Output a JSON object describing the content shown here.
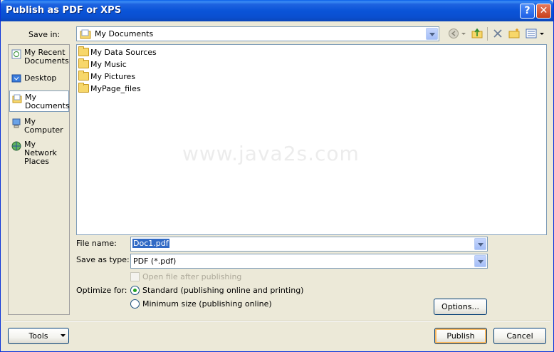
{
  "window": {
    "title": "Publish as PDF or XPS",
    "help_glyph": "?",
    "close_glyph": "✕"
  },
  "save_in": {
    "label": "Save in:",
    "value": "My Documents"
  },
  "places": [
    {
      "label": "My Recent Documents",
      "icon": "recent-documents-icon"
    },
    {
      "label": "Desktop",
      "icon": "desktop-icon"
    },
    {
      "label": "My Documents",
      "icon": "my-documents-icon"
    },
    {
      "label": "My Computer",
      "icon": "my-computer-icon"
    },
    {
      "label": "My Network Places",
      "icon": "network-places-icon"
    }
  ],
  "files": [
    {
      "name": "My Data Sources"
    },
    {
      "name": "My Music"
    },
    {
      "name": "My Pictures"
    },
    {
      "name": "MyPage_files"
    }
  ],
  "watermark": "www.java2s.com",
  "file_name": {
    "label": "File name:",
    "value": "Doc1.pdf"
  },
  "save_as_type": {
    "label": "Save as type:",
    "value": "PDF (*.pdf)"
  },
  "open_after": {
    "label": "Open file after publishing"
  },
  "optimize": {
    "label": "Optimize for:",
    "standard": "Standard (publishing online and printing)",
    "minimum": "Minimum size (publishing online)"
  },
  "buttons": {
    "options": "Options...",
    "tools": "Tools",
    "publish": "Publish",
    "cancel": "Cancel"
  },
  "colors": {
    "title_bar": "#0a54d8",
    "dialog_bg": "#ece9d8",
    "selection": "#316ac5",
    "border": "#7f9db9"
  }
}
